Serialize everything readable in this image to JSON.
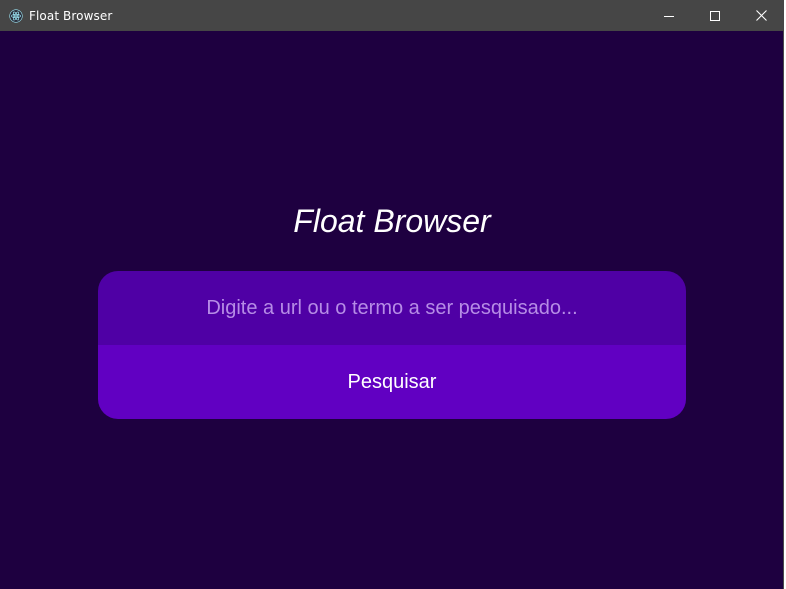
{
  "window": {
    "title": "Float Browser",
    "app_icon": "electron-atom-icon",
    "controls": {
      "minimize_icon": "minimize-icon",
      "maximize_icon": "maximize-icon",
      "close_icon": "close-icon"
    }
  },
  "main": {
    "heading": "Float Browser",
    "search": {
      "value": "",
      "placeholder": "Digite a url ou o termo a ser pesquisado...",
      "button_label": "Pesquisar"
    }
  },
  "colors": {
    "titlebar": "#464646",
    "background": "#1e0040",
    "input_background": "#4f00a5",
    "button_background": "#6100c2",
    "placeholder_text": "#b68ce6",
    "text": "#ffffff"
  }
}
